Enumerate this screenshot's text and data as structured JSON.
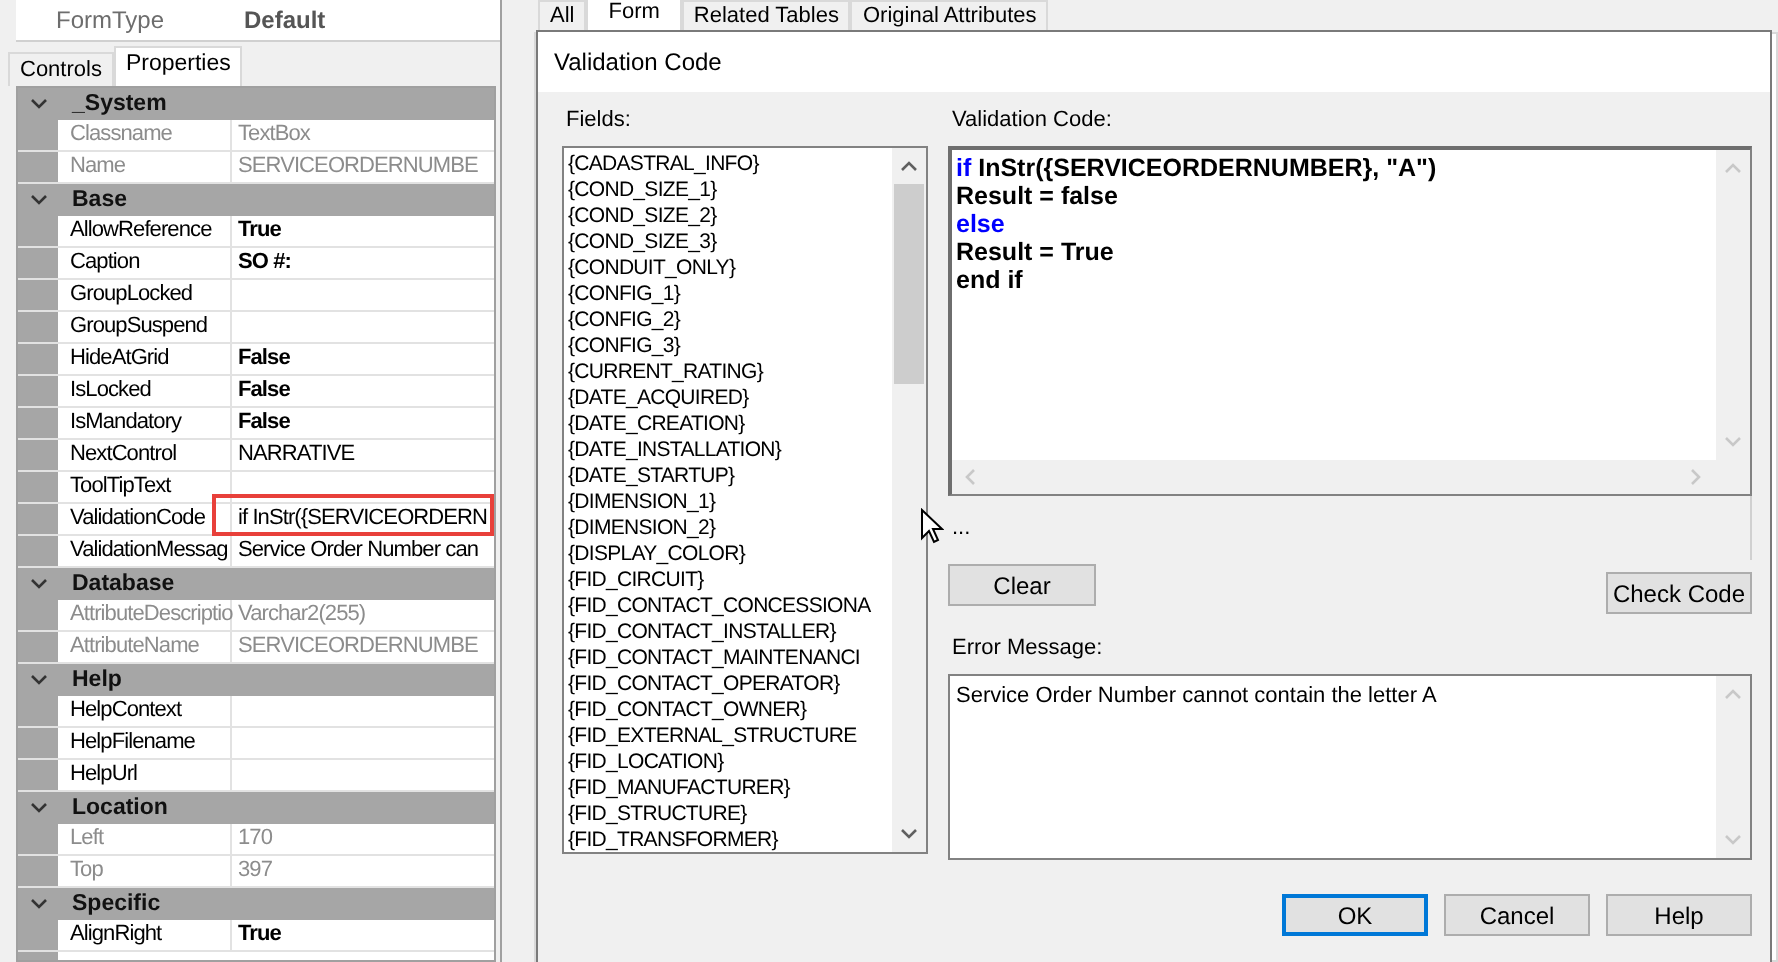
{
  "form_type": {
    "label": "FormType",
    "value": "Default"
  },
  "left_tabs": [
    {
      "label": "Controls",
      "selected": false
    },
    {
      "label": "Properties",
      "selected": true
    }
  ],
  "property_grid": [
    {
      "name": "_System",
      "expanded": true,
      "properties": [
        {
          "name": "Classname",
          "value": "TextBox",
          "disabled": true,
          "modified": false
        },
        {
          "name": "Name",
          "value": "SERVICEORDERNUMBE",
          "disabled": true,
          "modified": false
        }
      ]
    },
    {
      "name": "Base",
      "expanded": true,
      "properties": [
        {
          "name": "AllowReference",
          "value": "True",
          "disabled": false,
          "modified": true
        },
        {
          "name": "Caption",
          "value": "SO #:",
          "disabled": false,
          "modified": true
        },
        {
          "name": "GroupLocked",
          "disabled": false
        },
        {
          "name": "GroupSuspend",
          "disabled": false
        },
        {
          "name": "HideAtGrid",
          "value": "False",
          "disabled": false,
          "modified": true
        },
        {
          "name": "IsLocked",
          "value": "False",
          "disabled": false,
          "modified": true
        },
        {
          "name": "IsMandatory",
          "value": "False",
          "disabled": false,
          "modified": true
        },
        {
          "name": "NextControl",
          "value": "NARRATIVE",
          "disabled": false,
          "modified": false
        },
        {
          "name": "ToolTipText",
          "disabled": false
        },
        {
          "name": "ValidationCode",
          "value": "if InStr({SERVICEORDERN",
          "disabled": false,
          "modified": false,
          "highlighted": true
        },
        {
          "name": "ValidationMessag",
          "value": "Service Order Number can",
          "disabled": false,
          "modified": false
        }
      ]
    },
    {
      "name": "Database",
      "expanded": true,
      "properties": [
        {
          "name": "AttributeDescriptio",
          "value": "Varchar2(255)",
          "disabled": true,
          "modified": false
        },
        {
          "name": "AttributeName",
          "value": "SERVICEORDERNUMBE",
          "disabled": true,
          "modified": false
        }
      ]
    },
    {
      "name": "Help",
      "expanded": true,
      "properties": [
        {
          "name": "HelpContext",
          "disabled": false
        },
        {
          "name": "HelpFilename",
          "disabled": false
        },
        {
          "name": "HelpUrl",
          "disabled": false
        }
      ]
    },
    {
      "name": "Location",
      "expanded": true,
      "properties": [
        {
          "name": "Left",
          "value": "170",
          "disabled": true,
          "modified": false
        },
        {
          "name": "Top",
          "value": "397",
          "disabled": true,
          "modified": false
        }
      ]
    },
    {
      "name": "Specific",
      "expanded": true,
      "properties": [
        {
          "name": "AlignRight",
          "value": "True",
          "disabled": false,
          "modified": true
        }
      ]
    }
  ],
  "document_tabs": [
    {
      "label": "All",
      "selected": false
    },
    {
      "label": "Form",
      "selected": true
    },
    {
      "label": "Related Tables",
      "selected": false
    },
    {
      "label": "Original Attributes",
      "selected": false
    }
  ],
  "dialog": {
    "title": "Validation Code",
    "fields_label": "Fields:",
    "fields": [
      "{CADASTRAL_INFO}",
      "{COND_SIZE_1}",
      "{COND_SIZE_2}",
      "{COND_SIZE_3}",
      "{CONDUIT_ONLY}",
      "{CONFIG_1}",
      "{CONFIG_2}",
      "{CONFIG_3}",
      "{CURRENT_RATING}",
      "{DATE_ACQUIRED}",
      "{DATE_CREATION}",
      "{DATE_INSTALLATION}",
      "{DATE_STARTUP}",
      "{DIMENSION_1}",
      "{DIMENSION_2}",
      "{DISPLAY_COLOR}",
      "{FID_CIRCUIT}",
      "{FID_CONTACT_CONCESSIONA",
      "{FID_CONTACT_INSTALLER}",
      "{FID_CONTACT_MAINTENANCI",
      "{FID_CONTACT_OPERATOR}",
      "{FID_CONTACT_OWNER}",
      "{FID_EXTERNAL_STRUCTURE",
      "{FID_LOCATION}",
      "{FID_MANUFACTURER}",
      "{FID_STRUCTURE}",
      "{FID_TRANSFORMER}"
    ],
    "code_label": "Validation Code:",
    "code_lines": [
      [
        {
          "kind": "keyword",
          "text": "if"
        },
        {
          "kind": "plain",
          "text": " InStr({SERVICEORDERNUMBER}, \"A\")"
        }
      ],
      [
        {
          "kind": "plain",
          "text": "Result = false"
        }
      ],
      [
        {
          "kind": "keyword",
          "text": "else"
        }
      ],
      [
        {
          "kind": "plain",
          "text": "Result = True"
        }
      ],
      [
        {
          "kind": "plain",
          "text": "end if"
        }
      ]
    ],
    "status_text": "...",
    "clear_button": "Clear",
    "check_button": "Check Code",
    "error_label": "Error Message:",
    "error_message": "Service Order Number cannot contain the letter A",
    "footer_buttons": [
      {
        "label": "OK",
        "default": true
      },
      {
        "label": "Cancel",
        "default": false
      },
      {
        "label": "Help",
        "default": false
      }
    ]
  }
}
